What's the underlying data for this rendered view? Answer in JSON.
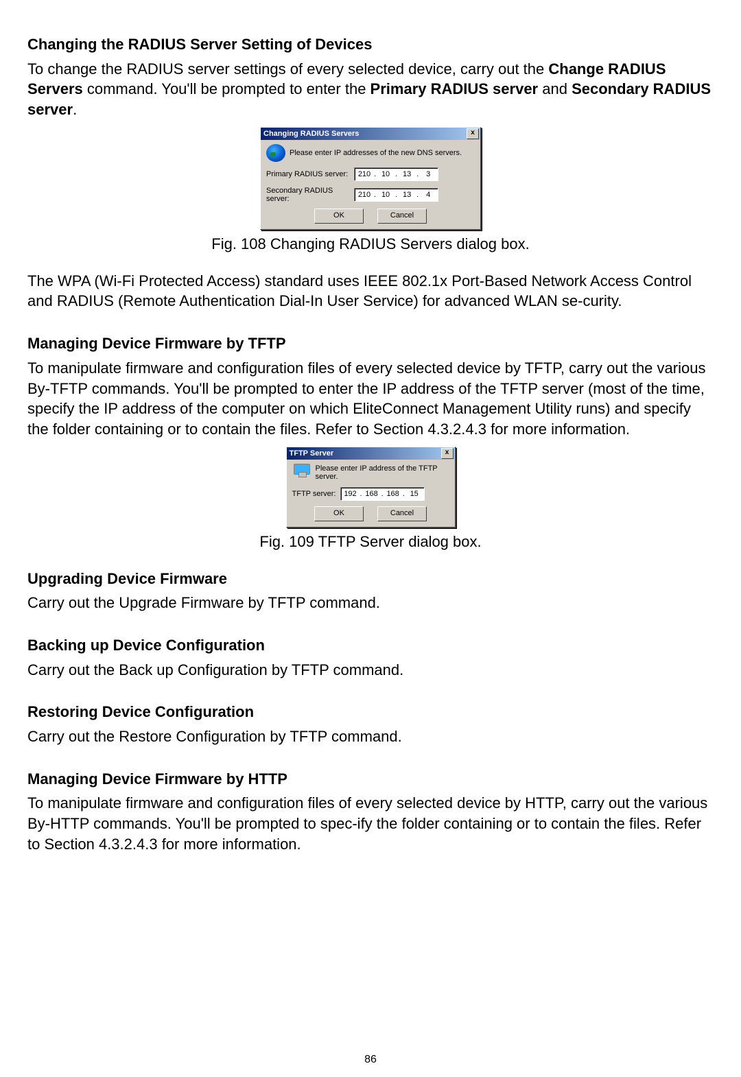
{
  "sections": {
    "s1": {
      "heading": "Changing the RADIUS Server Setting of Devices",
      "p1a": "To change the RADIUS server settings of every selected device, carry out the ",
      "p1b": "Change RADIUS Servers",
      "p1c": " command. You'll be prompted to enter the ",
      "p1d": "Primary RADIUS server",
      "p1e": " and ",
      "p1f": "Secondary RADIUS server",
      "p1g": "."
    },
    "fig1_caption": "Fig. 108 Changing RADIUS Servers dialog box.",
    "p2": "The WPA (Wi-Fi Protected Access) standard uses IEEE 802.1x Port-Based Network Access Control and RADIUS (Remote Authentication Dial-In User Service) for advanced WLAN se-curity.",
    "s2": {
      "heading": "Managing Device Firmware by TFTP",
      "body": "To manipulate firmware and configuration files of every selected device by TFTP, carry out the various By-TFTP commands. You'll be prompted to enter the IP address of the TFTP server (most of the time, specify the IP address of the computer on which EliteConnect Management Utility runs) and specify the folder containing or to contain the files. Refer to Section 4.3.2.4.3 for more information."
    },
    "fig2_caption": "Fig. 109 TFTP Server dialog box.",
    "s3": {
      "heading": "Upgrading Device Firmware",
      "body": "Carry out the Upgrade Firmware by TFTP command."
    },
    "s4": {
      "heading": "Backing up Device Configuration",
      "body": "Carry out the Back up Configuration by TFTP command."
    },
    "s5": {
      "heading": "Restoring Device Configuration",
      "body": "Carry out the Restore Configuration by TFTP command."
    },
    "s6": {
      "heading": "Managing Device Firmware by HTTP",
      "body": "To manipulate firmware and configuration files of every selected device by HTTP, carry out the various By-HTTP commands. You'll be prompted to spec-ify the folder containing or to contain the files. Refer to Section 4.3.2.4.3 for more information."
    }
  },
  "dialog_radius": {
    "title": "Changing RADIUS Servers",
    "close_x": "x",
    "prompt": "Please enter IP addresses of the new DNS servers.",
    "primary_label": "Primary RADIUS server:",
    "secondary_label": "Secondary RADIUS server:",
    "primary_ip": [
      "210",
      "10",
      "13",
      "3"
    ],
    "secondary_ip": [
      "210",
      "10",
      "13",
      "4"
    ],
    "ok": "OK",
    "cancel": "Cancel",
    "dot": "."
  },
  "dialog_tftp": {
    "title": "TFTP Server",
    "close_x": "x",
    "prompt": "Please enter IP address of the TFTP server.",
    "server_label": "TFTP server:",
    "ip": [
      "192",
      "168",
      "168",
      "15"
    ],
    "ok": "OK",
    "cancel": "Cancel",
    "dot": "."
  },
  "page_number": "86"
}
